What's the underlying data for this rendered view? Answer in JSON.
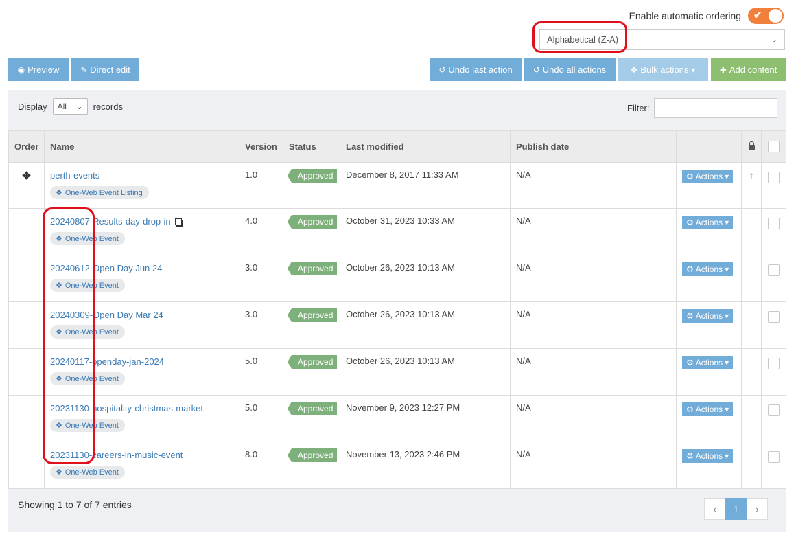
{
  "auto_ordering": {
    "label": "Enable automatic ordering",
    "enabled": true
  },
  "ordering": {
    "selected": "Alphabetical (Z-A)"
  },
  "toolbar": {
    "preview": "Preview",
    "direct_edit": "Direct edit",
    "undo_last": "Undo last action",
    "undo_all": "Undo all actions",
    "bulk_actions": "Bulk actions",
    "add_content": "Add content"
  },
  "display": {
    "label": "Display",
    "value": "All",
    "suffix": "records"
  },
  "filter": {
    "label": "Filter:",
    "value": ""
  },
  "columns": {
    "order": "Order",
    "name": "Name",
    "version": "Version",
    "status": "Status",
    "last_modified": "Last modified",
    "publish_date": "Publish date"
  },
  "rows": [
    {
      "name": "perth-events",
      "type": "One-Web Event Listing",
      "version": "1.0",
      "status": "Approved",
      "last_modified": "December 8, 2017 11:33 AM",
      "publish_date": "N/A",
      "actions": "Actions"
    },
    {
      "name": "20240807-Results-day-drop-in",
      "type": "One-Web Event",
      "version": "4.0",
      "status": "Approved",
      "last_modified": "October 31, 2023 10:33 AM",
      "publish_date": "N/A",
      "actions": "Actions"
    },
    {
      "name": "20240612-Open Day Jun 24",
      "type": "One-Web Event",
      "version": "3.0",
      "status": "Approved",
      "last_modified": "October 26, 2023 10:13 AM",
      "publish_date": "N/A",
      "actions": "Actions"
    },
    {
      "name": "20240309-Open Day Mar 24",
      "type": "One-Web Event",
      "version": "3.0",
      "status": "Approved",
      "last_modified": "October 26, 2023 10:13 AM",
      "publish_date": "N/A",
      "actions": "Actions"
    },
    {
      "name": "20240117-openday-jan-2024",
      "type": "One-Web Event",
      "version": "5.0",
      "status": "Approved",
      "last_modified": "October 26, 2023 10:13 AM",
      "publish_date": "N/A",
      "actions": "Actions"
    },
    {
      "name": "20231130-hospitality-christmas-market",
      "type": "One-Web Event",
      "version": "5.0",
      "status": "Approved",
      "last_modified": "November 9, 2023 12:27 PM",
      "publish_date": "N/A",
      "actions": "Actions"
    },
    {
      "name": "20231130-careers-in-music-event",
      "type": "One-Web Event",
      "version": "8.0",
      "status": "Approved",
      "last_modified": "November 13, 2023 2:46 PM",
      "publish_date": "N/A",
      "actions": "Actions"
    }
  ],
  "footer": {
    "showing": "Showing 1 to 7 of 7 entries"
  },
  "pagination": {
    "prev": "‹",
    "current": "1",
    "next": "›"
  },
  "colors": {
    "accent_blue": "#72acd9",
    "approved_green": "#7db07a",
    "toggle_orange": "#f0803c",
    "highlight_red": "#e0101a"
  },
  "icons": {
    "preview": "eye-icon",
    "direct_edit": "pencil-icon",
    "undo": "undo-icon",
    "bulk": "cubes-icon",
    "add": "plus-icon",
    "actions": "gear-icon",
    "move": "move-icon",
    "lock": "lock-icon",
    "up": "arrow-up-icon",
    "external": "window-restore-icon"
  }
}
